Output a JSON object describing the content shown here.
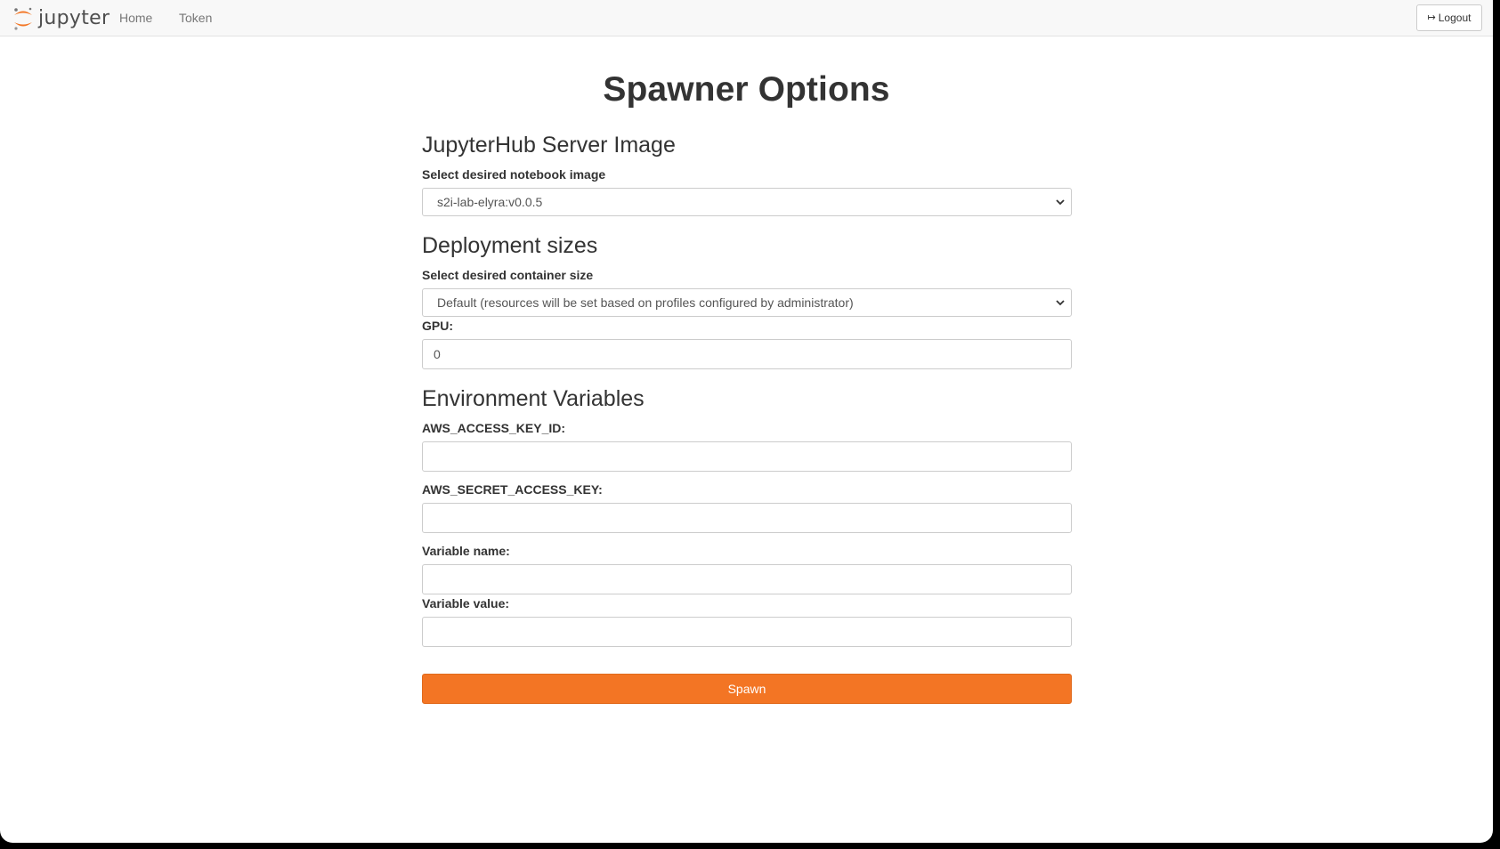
{
  "nav": {
    "logo_text": "jupyter",
    "home": "Home",
    "token": "Token",
    "logout": "Logout"
  },
  "page_title": "Spawner Options",
  "image_section": {
    "heading": "JupyterHub Server Image",
    "label": "Select desired notebook image",
    "selected": "s2i-lab-elyra:v0.0.5"
  },
  "deployment_section": {
    "heading": "Deployment sizes",
    "label": "Select desired container size",
    "selected": "Default (resources will be set based on profiles configured by administrator)",
    "gpu_label": "GPU:",
    "gpu_value": "0"
  },
  "env_section": {
    "heading": "Environment Variables",
    "aws_key_label": "AWS_ACCESS_KEY_ID:",
    "aws_key_value": "",
    "aws_secret_label": "AWS_SECRET_ACCESS_KEY:",
    "aws_secret_value": "",
    "var_name_label": "Variable name:",
    "var_name_value": "",
    "var_value_label": "Variable value:",
    "var_value_value": ""
  },
  "spawn_button": "Spawn",
  "colors": {
    "accent": "#f37524",
    "navbar_bg": "#f8f8f8"
  }
}
